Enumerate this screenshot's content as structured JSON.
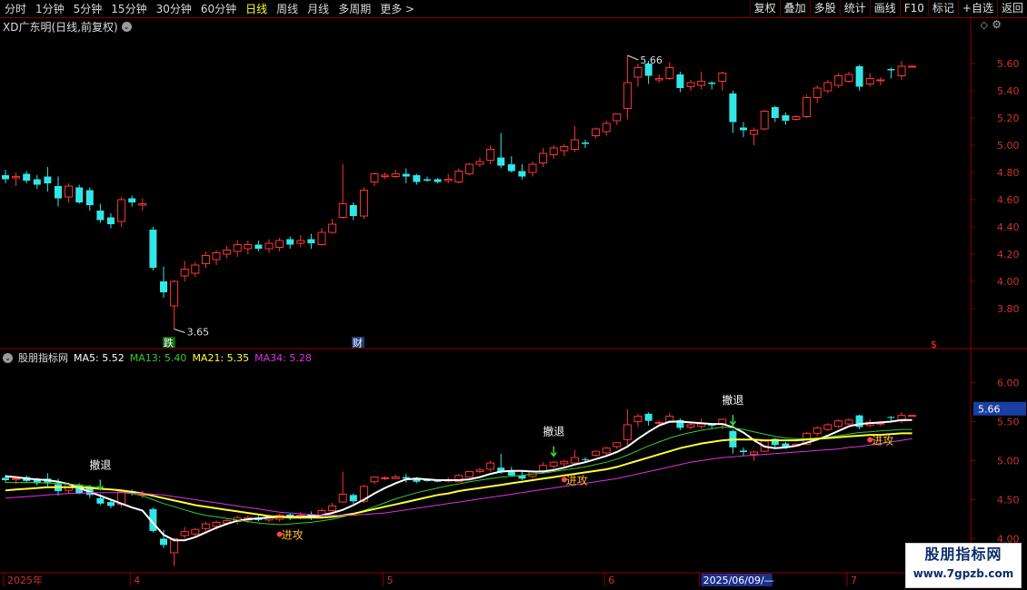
{
  "toolbar": {
    "periods": [
      "分时",
      "1分钟",
      "5分钟",
      "15分钟",
      "30分钟",
      "60分钟",
      "日线",
      "周线",
      "月线",
      "多周期",
      "更多 >"
    ],
    "active": "日线",
    "right_buttons": [
      "复权",
      "叠加",
      "多股",
      "统计",
      "画线",
      "F10",
      "标记",
      "+自选",
      "返回"
    ]
  },
  "header": {
    "stock_title": "XD广东明(日线,前复权)",
    "icon": "chevron-down-icon"
  },
  "indicator": {
    "name": "股朋指标网",
    "ma5_label": "MA5: 5.52",
    "ma13_label": "MA13: 5.40",
    "ma21_label": "MA21: 5.35",
    "ma34_label": "MA34: 5.28",
    "colors": {
      "ma5": "#ffffff",
      "ma13": "#33cc33",
      "ma21": "#ffff33",
      "ma34": "#dd33dd"
    },
    "signal_retreat": "撤退",
    "signal_attack": "进攻",
    "current_value": "5.66"
  },
  "markers": {
    "die": "跌",
    "cai": "财",
    "dollar": "$"
  },
  "watermark": {
    "line1": "股朋指标网",
    "line2": "www.7gpzb.com"
  },
  "chart_data": [
    {
      "type": "candlestick",
      "title": "XD广东明(日线,前复权)",
      "y_ticks": [
        "5.60",
        "5.40",
        "5.20",
        "5.00",
        "4.80",
        "4.60",
        "4.40",
        "4.20",
        "4.00",
        "3.80"
      ],
      "ylim": [
        3.6,
        5.8
      ],
      "annotations": [
        {
          "label": "5.66",
          "kind": "high"
        },
        {
          "label": "3.65",
          "kind": "low"
        }
      ],
      "colors": {
        "up": "#ff3333",
        "down": "#33e6e6"
      },
      "candles": [
        [
          4.78,
          4.75,
          4.82,
          4.72
        ],
        [
          4.76,
          4.77,
          4.8,
          4.7
        ],
        [
          4.79,
          4.74,
          4.81,
          4.72
        ],
        [
          4.75,
          4.71,
          4.78,
          4.68
        ],
        [
          4.77,
          4.72,
          4.84,
          4.66
        ],
        [
          4.7,
          4.61,
          4.77,
          4.55
        ],
        [
          4.62,
          4.7,
          4.72,
          4.58
        ],
        [
          4.69,
          4.58,
          4.71,
          4.57
        ],
        [
          4.67,
          4.56,
          4.69,
          4.52
        ],
        [
          4.52,
          4.45,
          4.57,
          4.43
        ],
        [
          4.47,
          4.42,
          4.5,
          4.39
        ],
        [
          4.44,
          4.6,
          4.62,
          4.4
        ],
        [
          4.61,
          4.58,
          4.63,
          4.55
        ],
        [
          4.56,
          4.57,
          4.61,
          4.52
        ],
        [
          4.38,
          4.1,
          4.4,
          4.08
        ],
        [
          4.0,
          3.92,
          4.11,
          3.88
        ],
        [
          3.82,
          4.0,
          4.01,
          3.65
        ],
        [
          4.04,
          4.09,
          4.15,
          4.0
        ],
        [
          4.06,
          4.12,
          4.14,
          4.03
        ],
        [
          4.13,
          4.19,
          4.22,
          4.1
        ],
        [
          4.16,
          4.21,
          4.23,
          4.12
        ],
        [
          4.2,
          4.23,
          4.26,
          4.17
        ],
        [
          4.22,
          4.27,
          4.3,
          4.18
        ],
        [
          4.24,
          4.27,
          4.3,
          4.2
        ],
        [
          4.27,
          4.24,
          4.3,
          4.22
        ],
        [
          4.24,
          4.28,
          4.31,
          4.21
        ],
        [
          4.25,
          4.3,
          4.32,
          4.22
        ],
        [
          4.31,
          4.27,
          4.33,
          4.24
        ],
        [
          4.28,
          4.3,
          4.34,
          4.25
        ],
        [
          4.31,
          4.28,
          4.35,
          4.24
        ],
        [
          4.27,
          4.36,
          4.39,
          4.26
        ],
        [
          4.36,
          4.42,
          4.46,
          4.35
        ],
        [
          4.47,
          4.57,
          4.86,
          4.46
        ],
        [
          4.56,
          4.48,
          4.58,
          4.45
        ],
        [
          4.48,
          4.67,
          4.69,
          4.46
        ],
        [
          4.73,
          4.79,
          4.8,
          4.7
        ],
        [
          4.77,
          4.78,
          4.8,
          4.75
        ],
        [
          4.77,
          4.79,
          4.82,
          4.76
        ],
        [
          4.79,
          4.77,
          4.83,
          4.72
        ],
        [
          4.78,
          4.73,
          4.79,
          4.71
        ],
        [
          4.75,
          4.74,
          4.77,
          4.73
        ],
        [
          4.75,
          4.73,
          4.76,
          4.72
        ],
        [
          4.74,
          4.75,
          4.79,
          4.72
        ],
        [
          4.73,
          4.81,
          4.83,
          4.72
        ],
        [
          4.79,
          4.86,
          4.87,
          4.78
        ],
        [
          4.86,
          4.88,
          4.91,
          4.84
        ],
        [
          4.89,
          4.97,
          5.0,
          4.86
        ],
        [
          4.91,
          4.85,
          5.09,
          4.83
        ],
        [
          4.86,
          4.81,
          4.92,
          4.8
        ],
        [
          4.81,
          4.77,
          4.86,
          4.75
        ],
        [
          4.8,
          4.86,
          4.88,
          4.77
        ],
        [
          4.87,
          4.94,
          4.98,
          4.84
        ],
        [
          4.93,
          4.98,
          5.0,
          4.9
        ],
        [
          4.96,
          4.99,
          5.01,
          4.92
        ],
        [
          4.97,
          5.04,
          5.14,
          4.95
        ],
        [
          5.02,
          5.01,
          5.04,
          4.98
        ],
        [
          5.07,
          5.12,
          5.13,
          5.05
        ],
        [
          5.1,
          5.16,
          5.18,
          5.07
        ],
        [
          5.18,
          5.23,
          5.23,
          5.15
        ],
        [
          5.27,
          5.46,
          5.66,
          5.19
        ],
        [
          5.5,
          5.57,
          5.6,
          5.43
        ],
        [
          5.6,
          5.51,
          5.62,
          5.45
        ],
        [
          5.48,
          5.49,
          5.52,
          5.46
        ],
        [
          5.49,
          5.57,
          5.61,
          5.48
        ],
        [
          5.52,
          5.42,
          5.54,
          5.39
        ],
        [
          5.43,
          5.46,
          5.48,
          5.4
        ],
        [
          5.44,
          5.47,
          5.54,
          5.41
        ],
        [
          5.46,
          5.45,
          5.47,
          5.41
        ],
        [
          5.47,
          5.53,
          5.54,
          5.4
        ],
        [
          5.38,
          5.17,
          5.4,
          5.09
        ],
        [
          5.13,
          5.11,
          5.17,
          5.06
        ],
        [
          5.08,
          5.11,
          5.13,
          5.0
        ],
        [
          5.12,
          5.25,
          5.26,
          5.11
        ],
        [
          5.28,
          5.2,
          5.29,
          5.17
        ],
        [
          5.22,
          5.18,
          5.24,
          5.15
        ],
        [
          5.19,
          5.21,
          5.22,
          5.18
        ],
        [
          5.21,
          5.35,
          5.37,
          5.2
        ],
        [
          5.35,
          5.42,
          5.44,
          5.31
        ],
        [
          5.4,
          5.46,
          5.48,
          5.38
        ],
        [
          5.44,
          5.51,
          5.53,
          5.42
        ],
        [
          5.47,
          5.52,
          5.54,
          5.46
        ],
        [
          5.58,
          5.43,
          5.59,
          5.4
        ],
        [
          5.45,
          5.49,
          5.53,
          5.43
        ],
        [
          5.48,
          5.48,
          5.5,
          5.44
        ],
        [
          5.56,
          5.55,
          5.57,
          5.49
        ],
        [
          5.51,
          5.58,
          5.62,
          5.48
        ],
        [
          5.58,
          5.58,
          5.59,
          5.58
        ]
      ]
    },
    {
      "type": "line",
      "title": "股朋指标网",
      "y_ticks": [
        "6.00",
        "5.50",
        "5.00",
        "4.50",
        "4.00"
      ],
      "ylim": [
        3.75,
        6.25
      ],
      "x_tick_labels": [
        "2025年",
        "4",
        "5",
        "6",
        "2025/06/09/—",
        "7"
      ],
      "series": [
        {
          "name": "MA5",
          "color": "#ffffff",
          "values": [
            4.8,
            4.79,
            4.77,
            4.76,
            4.75,
            4.73,
            4.7,
            4.65,
            4.6,
            4.55,
            4.5,
            4.45,
            4.4,
            4.36,
            4.2,
            4.05,
            3.98,
            3.98,
            4.02,
            4.08,
            4.14,
            4.19,
            4.23,
            4.25,
            4.26,
            4.27,
            4.28,
            4.28,
            4.28,
            4.29,
            4.3,
            4.33,
            4.37,
            4.43,
            4.5,
            4.58,
            4.65,
            4.71,
            4.76,
            4.77,
            4.76,
            4.75,
            4.75,
            4.75,
            4.76,
            4.79,
            4.83,
            4.86,
            4.87,
            4.87,
            4.86,
            4.86,
            4.88,
            4.91,
            4.95,
            4.98,
            5.02,
            5.06,
            5.11,
            5.18,
            5.28,
            5.37,
            5.45,
            5.5,
            5.5,
            5.49,
            5.48,
            5.47,
            5.47,
            5.43,
            5.36,
            5.26,
            5.18,
            5.16,
            5.17,
            5.19,
            5.23,
            5.27,
            5.32,
            5.38,
            5.44,
            5.47,
            5.48,
            5.49,
            5.5,
            5.52,
            5.52
          ]
        },
        {
          "name": "MA13",
          "color": "#33cc33",
          "values": [
            4.72,
            4.72,
            4.72,
            4.72,
            4.71,
            4.71,
            4.7,
            4.69,
            4.67,
            4.65,
            4.63,
            4.61,
            4.58,
            4.55,
            4.5,
            4.45,
            4.41,
            4.37,
            4.33,
            4.3,
            4.28,
            4.26,
            4.24,
            4.22,
            4.2,
            4.19,
            4.18,
            4.19,
            4.2,
            4.21,
            4.23,
            4.25,
            4.28,
            4.32,
            4.36,
            4.41,
            4.46,
            4.51,
            4.55,
            4.59,
            4.62,
            4.65,
            4.68,
            4.7,
            4.73,
            4.75,
            4.77,
            4.79,
            4.8,
            4.81,
            4.83,
            4.84,
            4.86,
            4.88,
            4.9,
            4.92,
            4.95,
            4.98,
            5.02,
            5.07,
            5.13,
            5.19,
            5.24,
            5.29,
            5.33,
            5.36,
            5.39,
            5.41,
            5.43,
            5.42,
            5.4,
            5.37,
            5.34,
            5.31,
            5.29,
            5.28,
            5.28,
            5.29,
            5.3,
            5.32,
            5.34,
            5.36,
            5.37,
            5.38,
            5.39,
            5.4,
            5.4
          ]
        },
        {
          "name": "MA21",
          "color": "#ffff33",
          "values": [
            4.62,
            4.63,
            4.64,
            4.65,
            4.66,
            4.66,
            4.66,
            4.66,
            4.65,
            4.64,
            4.63,
            4.62,
            4.6,
            4.58,
            4.55,
            4.52,
            4.49,
            4.46,
            4.43,
            4.41,
            4.39,
            4.37,
            4.35,
            4.33,
            4.31,
            4.29,
            4.28,
            4.27,
            4.27,
            4.27,
            4.27,
            4.28,
            4.3,
            4.32,
            4.35,
            4.38,
            4.41,
            4.44,
            4.47,
            4.5,
            4.53,
            4.56,
            4.58,
            4.61,
            4.63,
            4.65,
            4.67,
            4.69,
            4.71,
            4.73,
            4.75,
            4.77,
            4.79,
            4.81,
            4.83,
            4.85,
            4.87,
            4.89,
            4.92,
            4.96,
            5.0,
            5.04,
            5.08,
            5.12,
            5.16,
            5.19,
            5.22,
            5.24,
            5.26,
            5.27,
            5.27,
            5.27,
            5.26,
            5.26,
            5.26,
            5.26,
            5.27,
            5.28,
            5.29,
            5.3,
            5.31,
            5.32,
            5.33,
            5.33,
            5.34,
            5.35,
            5.35
          ]
        },
        {
          "name": "MA34",
          "color": "#dd33dd",
          "values": [
            4.52,
            4.53,
            4.54,
            4.55,
            4.56,
            4.57,
            4.58,
            4.58,
            4.59,
            4.59,
            4.59,
            4.59,
            4.58,
            4.58,
            4.57,
            4.56,
            4.54,
            4.52,
            4.5,
            4.48,
            4.46,
            4.44,
            4.42,
            4.4,
            4.38,
            4.36,
            4.34,
            4.33,
            4.32,
            4.31,
            4.3,
            4.3,
            4.3,
            4.3,
            4.31,
            4.32,
            4.33,
            4.35,
            4.37,
            4.39,
            4.41,
            4.43,
            4.45,
            4.47,
            4.49,
            4.51,
            4.53,
            4.55,
            4.57,
            4.59,
            4.61,
            4.63,
            4.65,
            4.67,
            4.69,
            4.71,
            4.73,
            4.75,
            4.77,
            4.8,
            4.83,
            4.86,
            4.89,
            4.92,
            4.95,
            4.98,
            5.0,
            5.02,
            5.04,
            5.05,
            5.06,
            5.07,
            5.08,
            5.09,
            5.1,
            5.11,
            5.12,
            5.13,
            5.14,
            5.15,
            5.17,
            5.18,
            5.2,
            5.22,
            5.24,
            5.26,
            5.28
          ]
        }
      ]
    }
  ]
}
